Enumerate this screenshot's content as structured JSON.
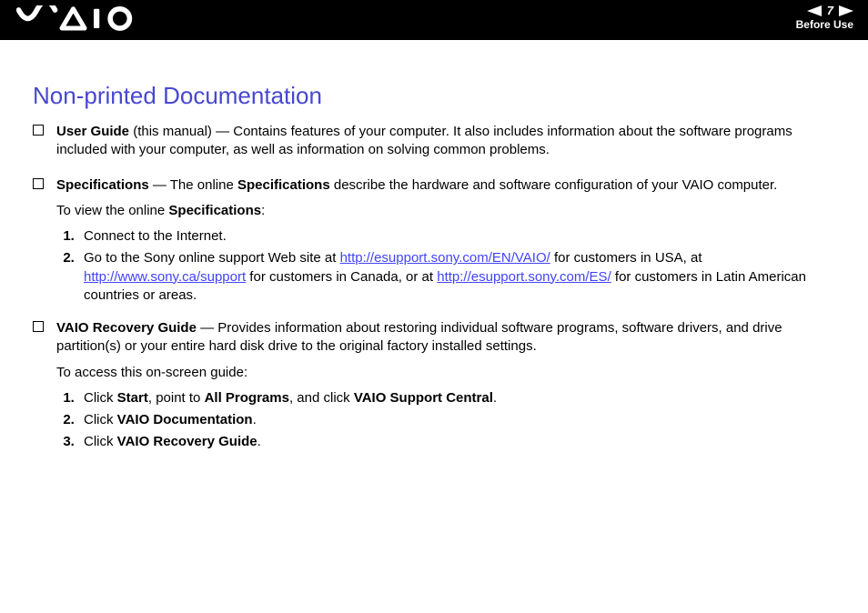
{
  "header": {
    "page_number": "7",
    "section_label": "Before Use"
  },
  "title": "Non-printed Documentation",
  "bullets": [
    {
      "lead_bold": "User Guide",
      "lead_rest": " (this manual) — Contains features of your computer. It also includes information about the software programs included with your computer, as well as information on solving common problems."
    },
    {
      "lead_bold": "Specifications",
      "lead_rest_a": " — The online ",
      "spec_bold": "Specifications",
      "lead_rest_b": " describe the hardware and software configuration of your VAIO computer.",
      "view_prefix": "To view the online ",
      "view_bold": "Specifications",
      "view_suffix": ":",
      "steps": {
        "s1": "Connect to the Internet.",
        "s2a": "Go to the Sony online support Web site at ",
        "s2_link1": "http://esupport.sony.com/EN/VAIO/",
        "s2b": " for customers in USA, at ",
        "s2_link2": "http://www.sony.ca/support",
        "s2c": " for customers in Canada, or at ",
        "s2_link3": "http://esupport.sony.com/ES/",
        "s2d": " for customers in Latin American countries or areas."
      }
    },
    {
      "lead_bold": "VAIO Recovery Guide",
      "lead_rest": " — Provides information about restoring individual software programs, software drivers, and drive partition(s) or your entire hard disk drive to the original factory installed settings.",
      "access_line": "To access this on-screen guide:",
      "steps": {
        "s1a": "Click ",
        "s1_b1": "Start",
        "s1b": ", point to ",
        "s1_b2": "All Programs",
        "s1c": ", and click ",
        "s1_b3": "VAIO Support Central",
        "s1d": ".",
        "s2a": "Click ",
        "s2_b1": "VAIO Documentation",
        "s2b": ".",
        "s3a": "Click ",
        "s3_b1": "VAIO Recovery Guide",
        "s3b": "."
      }
    }
  ]
}
